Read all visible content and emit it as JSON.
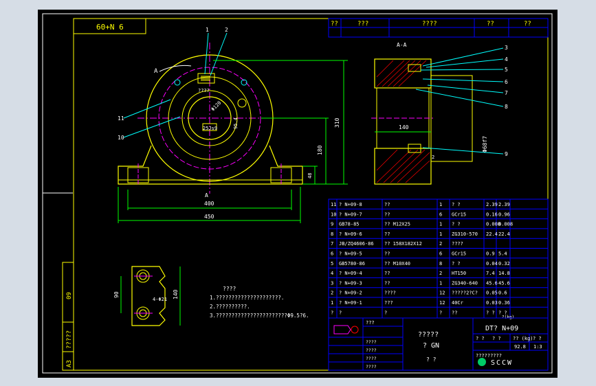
{
  "sheet": {
    "top_left_label": "60+N 6",
    "side_labels": [
      "A3",
      "?????",
      "09"
    ]
  },
  "top_table": {
    "headers": [
      "??",
      "???",
      "????",
      "??",
      "??"
    ]
  },
  "section": {
    "label": "A-A",
    "dim_width": "140",
    "dim_bore": "Φ68f7",
    "callouts": [
      "3",
      "4",
      "5",
      "6",
      "7",
      "8",
      "9"
    ],
    "small_label": "2"
  },
  "front_view": {
    "callouts": [
      "1",
      "2",
      "11",
      "10"
    ],
    "arrow_label": "A",
    "arrow_label_bottom": "A",
    "dims": {
      "base_inner": "400",
      "base_outer": "450",
      "height_total": "310",
      "height_center": "180",
      "height_base": "48",
      "bore": "Φ120",
      "keyway": "95.4",
      "key": "25Js9",
      "note": "????"
    }
  },
  "bolt_detail": {
    "dim_height": "90",
    "dim_side": "140",
    "dim_hole": "4-Φ21"
  },
  "notes": {
    "title": "????",
    "lines": [
      "1.?????????????????????.",
      "2.??????????.",
      "3.???????????????????????Φ9.5?6."
    ]
  },
  "parts": [
    {
      "no": "11",
      "code": "? N+09-8",
      "name": "??",
      "qty": "1",
      "mat": "? ?",
      "w1": "2.39",
      "w2": "2.39"
    },
    {
      "no": "10",
      "code": "? N+09-7",
      "name": "??",
      "qty": "6",
      "mat": "GCr15",
      "w1": "0.16",
      "w2": "0.96"
    },
    {
      "no": "9",
      "code": "GB78-85",
      "name": "?? M12X25",
      "qty": "1",
      "mat": "? ?",
      "w1": "0.008",
      "w2": "0.008"
    },
    {
      "no": "8",
      "code": "? N+09-6",
      "name": "??",
      "qty": "1",
      "mat": "ZG310-570",
      "w1": "22.4",
      "w2": "22.4"
    },
    {
      "no": "7",
      "code": "JB/ZQ4606-86",
      "name": "?? 158X182X12",
      "qty": "2",
      "mat": "????",
      "w1": "",
      "w2": ""
    },
    {
      "no": "6",
      "code": "? N+09-5",
      "name": "??",
      "qty": "6",
      "mat": "GCr15",
      "w1": "0.9",
      "w2": "5.4"
    },
    {
      "no": "5",
      "code": "GB5780-86",
      "name": "?? M10X40",
      "qty": "8",
      "mat": "? ?",
      "w1": "0.04",
      "w2": "0.32"
    },
    {
      "no": "4",
      "code": "? N+09-4",
      "name": "??",
      "qty": "2",
      "mat": "HT150",
      "w1": "7.4",
      "w2": "14.8"
    },
    {
      "no": "3",
      "code": "? N+09-3",
      "name": "??",
      "qty": "1",
      "mat": "ZG340-640",
      "w1": "45.6",
      "w2": "45.6"
    },
    {
      "no": "2",
      "code": "? N+09-2",
      "name": "????",
      "qty": "12",
      "mat": "?????2?C?",
      "w1": "0.05",
      "w2": "0.6"
    },
    {
      "no": "1",
      "code": "? N+09-1",
      "name": "???",
      "qty": "12",
      "mat": "40Cr",
      "w1": "0.03",
      "w2": "0.36"
    }
  ],
  "parts_header": {
    "no": "?",
    "code": "?",
    "name": "?",
    "qty": "?",
    "mat": "??",
    "w1": "? ?",
    "w2": "? ?"
  },
  "parts_header_sub": "?(kg)",
  "title_block": {
    "drawing_no": "DT? N+09",
    "name_line1": "?????",
    "name_line2": "? GN",
    "name_line3": "? ?",
    "header_cells": [
      "? ?",
      "? ?",
      "?? (kg)",
      "? ?"
    ],
    "weight": "92.8",
    "scale": "1:3",
    "company_cn": "?????????",
    "company_en": "SCCW",
    "check_label": "???",
    "sig_rows": [
      "????",
      "????",
      "????",
      "????"
    ]
  },
  "colors": {
    "bg": "#000000",
    "frame": "#ffffff",
    "outline": "#ffff00",
    "dim": "#00ff00",
    "center": "#ff00ff",
    "leader": "#00ffff",
    "table": "#0000ff",
    "hatch": "#ff0000"
  }
}
